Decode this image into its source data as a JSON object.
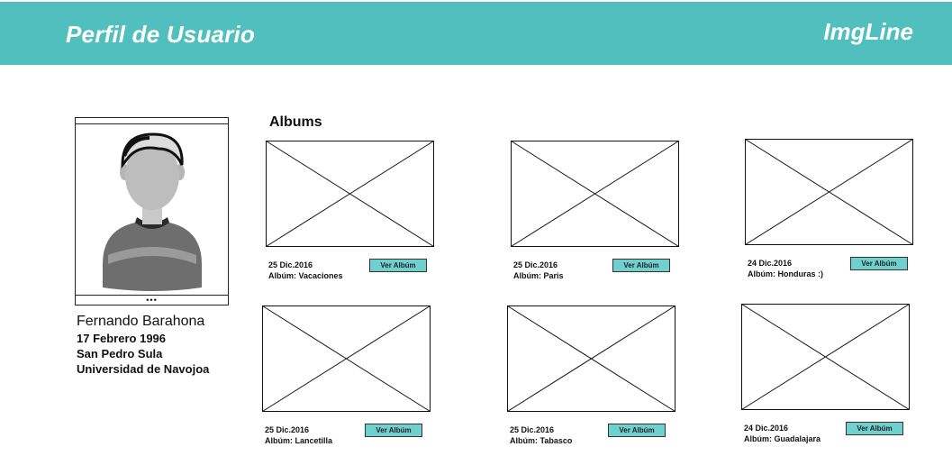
{
  "header": {
    "title": "Perfil de Usuario",
    "brand": "ImgLine"
  },
  "profile": {
    "more": "•••",
    "name": "Fernando Barahona",
    "birthdate": "17 Febrero 1996",
    "city": "San Pedro Sula",
    "school": "Universidad de Navojoa"
  },
  "albums": {
    "heading": "Albums",
    "items": [
      {
        "date": "25 Dic.2016",
        "title": "Albúm: Vacaciones",
        "button": "Ver Albúm"
      },
      {
        "date": "25 Dic.2016",
        "title": "Albúm: Paris",
        "button": "Ver Albúm"
      },
      {
        "date": "24 Dic.2016",
        "title": "Albúm: Honduras :)",
        "button": "Ver Albúm"
      },
      {
        "date": "25 Dic.2016",
        "title": "Albúm: Lancetilla",
        "button": "Ver Albúm"
      },
      {
        "date": "25 Dic.2016",
        "title": "Albúm: Tabasco",
        "button": "Ver Albúm"
      },
      {
        "date": "24 Dic.2016",
        "title": "Albúm: Guadalajara",
        "button": "Ver Albúm"
      }
    ]
  },
  "colors": {
    "header": "#52bfbf",
    "button": "#6fd0d0"
  }
}
